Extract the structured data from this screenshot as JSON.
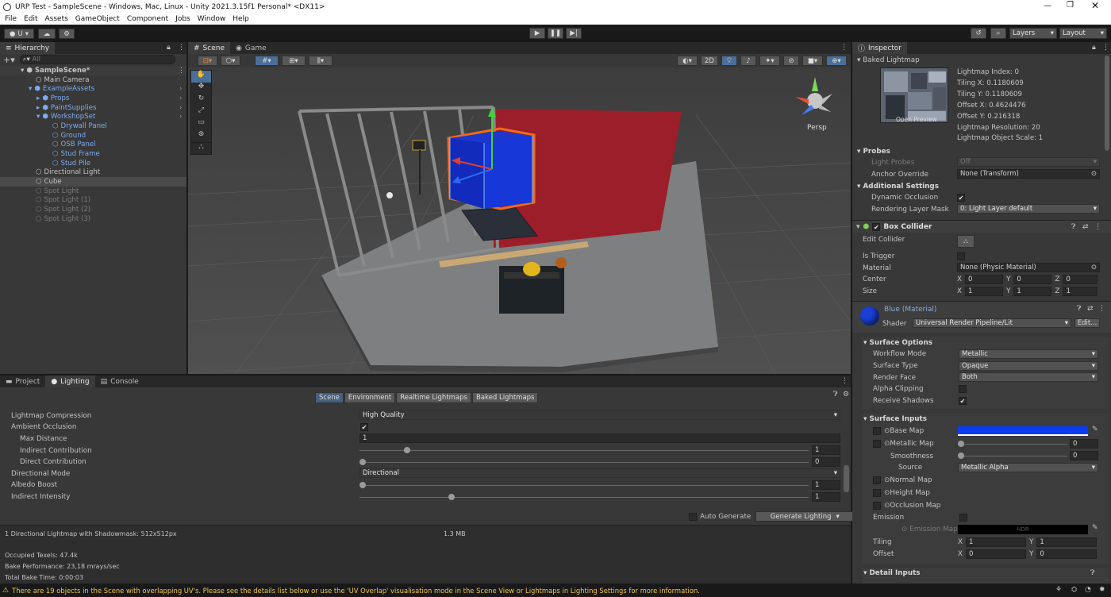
{
  "titlebar": {
    "title": "URP Test - SampleScene - Windows, Mac, Linux - Unity 2021.3.15f1 Personal* <DX11>"
  },
  "menu": [
    "File",
    "Edit",
    "Assets",
    "GameObject",
    "Component",
    "Jobs",
    "Window",
    "Help"
  ],
  "toolbar": {
    "account": "U",
    "layers": "Layers",
    "layout": "Layout"
  },
  "hierarchy": {
    "tab": "Hierarchy",
    "search_placeholder": "All",
    "items": [
      {
        "label": "SampleScene*"
      },
      {
        "label": "Main Camera"
      },
      {
        "label": "ExampleAssets"
      },
      {
        "label": "Props"
      },
      {
        "label": "PaintSupplies"
      },
      {
        "label": "WorkshopSet"
      },
      {
        "label": "Drywall Panel"
      },
      {
        "label": "Ground"
      },
      {
        "label": "OSB Panel"
      },
      {
        "label": "Stud Frame"
      },
      {
        "label": "Stud Pile"
      },
      {
        "label": "Directional Light"
      },
      {
        "label": "Cube"
      },
      {
        "label": "Spot Light"
      },
      {
        "label": "Spot Light (1)"
      },
      {
        "label": "Spot Light (2)"
      },
      {
        "label": "Spot Light (3)"
      }
    ]
  },
  "scene": {
    "tab_scene": "Scene",
    "tab_game": "Game",
    "btn_2d": "2D",
    "persp": "Persp"
  },
  "bottom": {
    "tabs": [
      "Project",
      "Lighting",
      "Console"
    ],
    "subtabs": [
      "Scene",
      "Environment",
      "Realtime Lightmaps",
      "Baked Lightmaps"
    ],
    "rows": {
      "lightmap_compression": {
        "label": "Lightmap Compression",
        "value": "High Quality"
      },
      "ambient_occlusion": {
        "label": "Ambient Occlusion"
      },
      "max_distance": {
        "label": "Max Distance",
        "value": "1"
      },
      "indirect_contribution": {
        "label": "Indirect Contribution",
        "value": "1",
        "fraction": 0.1
      },
      "direct_contribution": {
        "label": "Direct Contribution",
        "value": "0",
        "fraction": 0
      },
      "directional_mode": {
        "label": "Directional Mode",
        "value": "Directional"
      },
      "albedo_boost": {
        "label": "Albedo Boost",
        "value": "1",
        "fraction": 0
      },
      "indirect_intensity": {
        "label": "Indirect Intensity",
        "value": "1",
        "fraction": 0.2
      }
    },
    "auto_generate": "Auto Generate",
    "generate_lighting": "Generate Lighting",
    "stats": {
      "lightmap_info": "1 Directional Lightmap with Shadowmask: 512x512px",
      "size": "1.3 MB",
      "occupied": "Occupied Texels: 47.4k",
      "bake_perf": "Bake Performance: 23,18 mrays/sec",
      "bake_time": "Total Bake Time: 0:00:03"
    }
  },
  "inspector": {
    "tab": "Inspector",
    "baked_lightmap": {
      "title": "Baked Lightmap",
      "open_preview": "Open Preview",
      "lines": [
        "Lightmap Index: 0",
        "Tiling X: 0.1180609",
        "Tiling Y: 0.1180609",
        "Offset X: 0.4624476",
        "Offset Y: 0.216318",
        "Lightmap Resolution: 20",
        "Lightmap Object Scale: 1"
      ]
    },
    "probes": {
      "title": "Probes",
      "light_probes_label": "Light Probes",
      "light_probes_value": "Off",
      "anchor_label": "Anchor Override",
      "anchor_value": "None (Transform)"
    },
    "additional": {
      "title": "Additional Settings",
      "dynamic_occlusion": "Dynamic Occlusion",
      "rendering_layer_label": "Rendering Layer Mask",
      "rendering_layer_value": "0: Light Layer default"
    },
    "box_collider": {
      "title": "Box Collider",
      "edit_collider": "Edit Collider",
      "is_trigger": "Is Trigger",
      "material_label": "Material",
      "material_value": "None (Physic Material)",
      "center_label": "Center",
      "center": {
        "x": "0",
        "y": "0",
        "z": "0"
      },
      "size_label": "Size",
      "size": {
        "x": "1",
        "y": "1",
        "z": "1"
      }
    },
    "material": {
      "title": "Blue (Material)",
      "shader_label": "Shader",
      "shader_value": "Universal Render Pipeline/Lit",
      "edit": "Edit...",
      "swatch": "#1a3fd6"
    },
    "surface_options": {
      "title": "Surface Options",
      "workflow_label": "Workflow Mode",
      "workflow_value": "Metallic",
      "surface_label": "Surface Type",
      "surface_value": "Opaque",
      "render_face_label": "Render Face",
      "render_face_value": "Both",
      "alpha_clip_label": "Alpha Clipping",
      "receive_shadows_label": "Receive Shadows"
    },
    "surface_inputs": {
      "title": "Surface Inputs",
      "base_map": "Base Map",
      "base_color": "#0a3cf0",
      "metallic_map": "Metallic Map",
      "metallic_value": "0",
      "smoothness": "Smoothness",
      "smoothness_value": "0",
      "source_label": "Source",
      "source_value": "Metallic Alpha",
      "normal_map": "Normal Map",
      "height_map": "Height Map",
      "occlusion_map": "Occlusion Map",
      "emission": "Emission",
      "emission_map": "Emission Map",
      "hdr": "HDR",
      "tiling_label": "Tiling",
      "tiling": {
        "x": "1",
        "y": "1"
      },
      "offset_label": "Offset",
      "offset": {
        "x": "0",
        "y": "0"
      }
    },
    "detail_inputs": {
      "title": "Detail Inputs"
    }
  },
  "status": {
    "warning": "There are 19 objects in the Scene with overlapping UV's. Please see the details list below or use the 'UV Overlap' visualisation mode in the Scene View or Lightmaps in Lighting Settings for more information."
  },
  "colors": {
    "accent_blue": "#7cabf2",
    "selection": "#2c5d87",
    "warning": "#f2c744"
  }
}
